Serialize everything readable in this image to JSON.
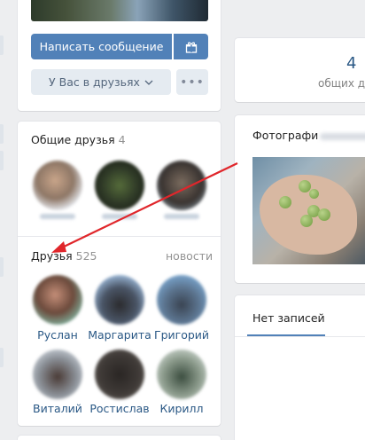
{
  "profile_actions": {
    "message_button": "Написать сообщение",
    "gift_icon": "gift-icon",
    "friend_status_button": "У Вас в друзьях",
    "more_icon": "more-icon"
  },
  "common_friends": {
    "title": "Общие друзья",
    "count": "4"
  },
  "friends": {
    "title": "Друзья",
    "count": "525",
    "news_link": "новости",
    "row1": [
      "Руслан",
      "Маргарита",
      "Григорий"
    ],
    "row2": [
      "Виталий",
      "Ростислав",
      "Кирилл"
    ]
  },
  "counters": {
    "common_friends_num": "4",
    "common_friends_label": "общих др"
  },
  "photos": {
    "title": "Фотографи"
  },
  "wall": {
    "tab_label": "Нет записей"
  },
  "colors": {
    "accent": "#5181b8",
    "link": "#2a5885",
    "arrow": "#e0262b"
  }
}
